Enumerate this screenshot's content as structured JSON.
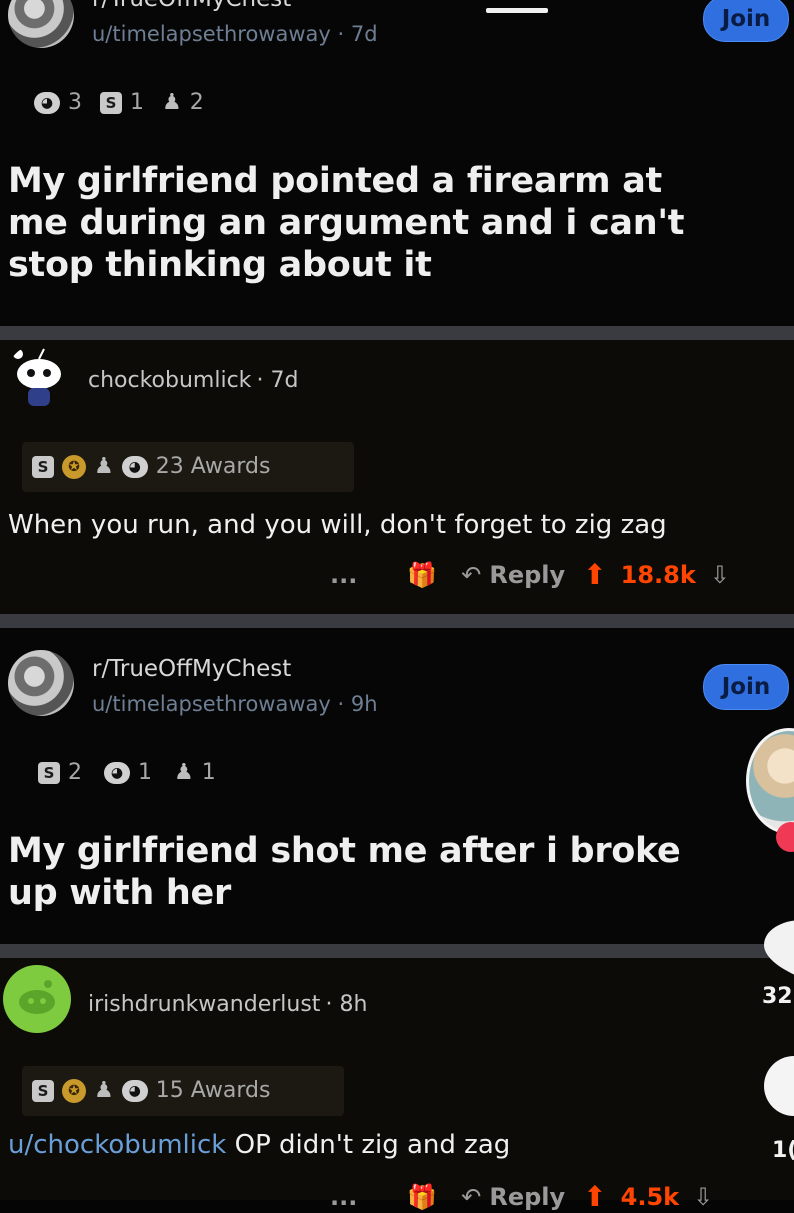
{
  "post1": {
    "subreddit": "r/TrueOffMyChest",
    "user": "u/timelapsethrowaway",
    "time": "7d",
    "join_label": "Join",
    "award_counts": [
      "3",
      "1",
      "2"
    ],
    "title": "My girlfriend pointed a firearm at me during an argument and i can't stop thinking about it"
  },
  "comment1": {
    "user": "chockobumlick",
    "time": "7d",
    "awards_label": "23 Awards",
    "body": "When you run, and you will, don't forget to zig zag",
    "more_label": "...",
    "reply_label": "Reply",
    "score": "18.8k"
  },
  "post2": {
    "subreddit": "r/TrueOffMyChest",
    "user": "u/timelapsethrowaway",
    "time": "9h",
    "join_label": "Join",
    "award_counts": [
      "2",
      "1",
      "1"
    ],
    "title": "My girlfriend shot me after i broke up with her"
  },
  "comment2": {
    "user": "irishdrunkwanderlust",
    "time": "8h",
    "awards_label": "15 Awards",
    "mention": "u/chockobumlick",
    "body": "OP didn't zig and zag",
    "more_label": "...",
    "reply_label": "Reply",
    "score": "4.5k"
  },
  "overlay": {
    "like_count": "32",
    "comment_count": "1("
  },
  "colors": {
    "accent_join": "#2f6fe0",
    "upvote": "#ff4500",
    "mention": "#6a9ed8"
  }
}
